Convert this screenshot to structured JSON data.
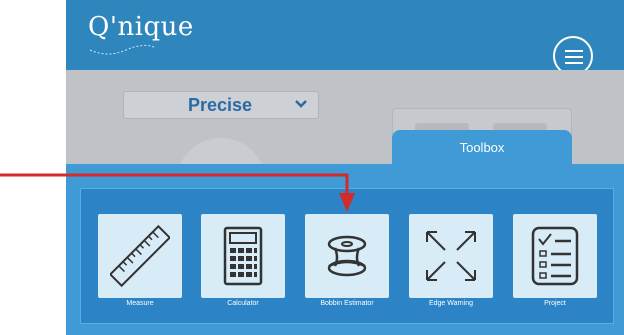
{
  "app": {
    "logo_text": "Q'nique",
    "menu_icon": "hamburger-menu-icon"
  },
  "mode_select": {
    "value": "Precise",
    "chevron_icon": "chevron-down-icon"
  },
  "toolbox": {
    "tab_label": "Toolbox",
    "tools": [
      {
        "label": "Measure",
        "icon": "ruler-icon"
      },
      {
        "label": "Calculator",
        "icon": "calculator-icon"
      },
      {
        "label": "Bobbin Estimator",
        "icon": "bobbin-icon"
      },
      {
        "label": "Edge Warning",
        "icon": "expand-arrows-icon"
      },
      {
        "label": "Project",
        "icon": "checklist-icon"
      }
    ]
  },
  "annotation": {
    "arrow_color": "#d32a2a",
    "arrow_icon": "callout-arrow-icon"
  },
  "colors": {
    "brand_blue": "#2f86bd",
    "toolbox_blue": "#3f9ad6",
    "tile_bg": "#d8ecf7",
    "icon_dark": "#333333"
  }
}
